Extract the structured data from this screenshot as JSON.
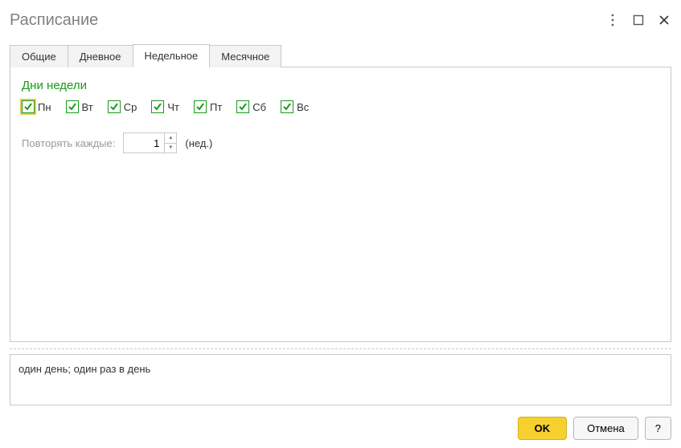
{
  "title": "Расписание",
  "tabs": {
    "general": "Общие",
    "daily": "Дневное",
    "weekly": "Недельное",
    "monthly": "Месячное",
    "active": "weekly"
  },
  "weekly": {
    "section_title": "Дни недели",
    "days": {
      "mon": {
        "label": "Пн",
        "checked": true
      },
      "tue": {
        "label": "Вт",
        "checked": true
      },
      "wed": {
        "label": "Ср",
        "checked": true
      },
      "thu": {
        "label": "Чт",
        "checked": true
      },
      "fri": {
        "label": "Пт",
        "checked": true
      },
      "sat": {
        "label": "Сб",
        "checked": true
      },
      "sun": {
        "label": "Вс",
        "checked": true
      }
    },
    "repeat_label": "Повторять каждые:",
    "repeat_value": "1",
    "repeat_unit": "(нед.)"
  },
  "summary": "один день; один раз в день",
  "buttons": {
    "ok": "OK",
    "cancel": "Отмена",
    "help": "?"
  }
}
